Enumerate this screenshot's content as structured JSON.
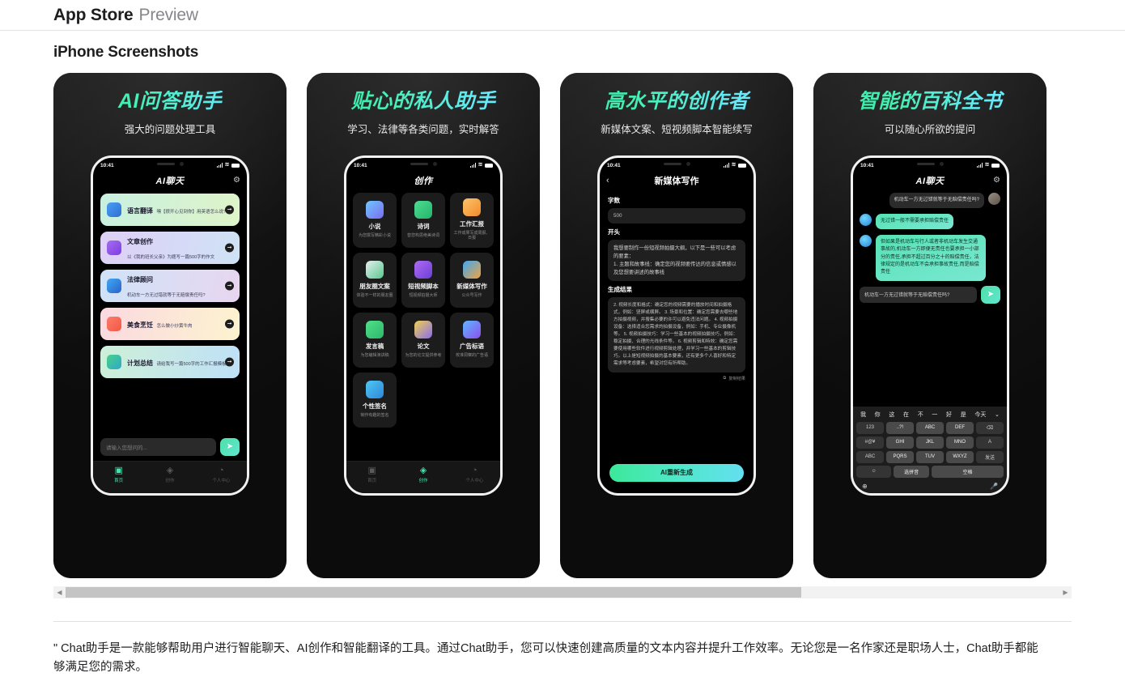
{
  "header": {
    "brand": "App Store",
    "preview": "Preview"
  },
  "section": {
    "title": "iPhone Screenshots"
  },
  "scrollbar": {
    "left_arrow": "◀",
    "right_arrow": "▶"
  },
  "description": "\" Chat助手是一款能够帮助用户进行智能聊天、AI创作和智能翻译的工具。通过Chat助手，您可以快速创建高质量的文本内容并提升工作效率。无论您是一名作家还是职场人士，Chat助手都能够满足您的需求。",
  "shots": [
    {
      "title": "AI问答助手",
      "subtitle": "强大的问题处理工具",
      "status": {
        "time": "10:41",
        "wifi": "◥"
      },
      "nav": {
        "title": "AI聊天",
        "right_icon": "⚙"
      },
      "cards": [
        {
          "title": "语言翻译",
          "desc": "嘿【很开心见到你】用英语怎么说?",
          "arrow": "➞"
        },
        {
          "title": "文章创作",
          "desc": "以《我的班长父亲》为题写一篇500字的作文",
          "arrow": "➞"
        },
        {
          "title": "法律顾问",
          "desc": "机动车一方无过错就等于无赔偿责任吗?",
          "arrow": "➞"
        },
        {
          "title": "美食烹饪",
          "desc": "怎么做小炒黄牛肉",
          "arrow": "➞"
        },
        {
          "title": "计划总结",
          "desc": "请给我写一篇500字的工作汇报模板",
          "arrow": "➞"
        }
      ],
      "input_placeholder": "请输入您想问的...",
      "send_icon": "➤",
      "tabs": [
        {
          "label": "首页",
          "icon": "▣",
          "active": true
        },
        {
          "label": "创作",
          "icon": "◈",
          "active": false
        },
        {
          "label": "个人中心",
          "icon": "◔",
          "active": false
        }
      ]
    },
    {
      "title": "贴心的私人助手",
      "subtitle": "学习、法律等各类问题，实时解答",
      "status": {
        "time": "10:41"
      },
      "nav": {
        "title": "创作"
      },
      "grid": [
        {
          "title": "小说",
          "desc": "为您撰写精彩小说"
        },
        {
          "title": "诗词",
          "desc": "替您构思绝美诗词"
        },
        {
          "title": "工作汇报",
          "desc": "工作成果写成周报、日报"
        },
        {
          "title": "朋友圈文案",
          "desc": "体验不一样的朋友圈"
        },
        {
          "title": "短视频脚本",
          "desc": "短视频拍摄大师"
        },
        {
          "title": "新媒体写作",
          "desc": "公众号写作"
        },
        {
          "title": "发言稿",
          "desc": "为您编辑演讲稿"
        },
        {
          "title": "论文",
          "desc": "为您的论文提供参考"
        },
        {
          "title": "广告标语",
          "desc": "校准洞察的广告语"
        },
        {
          "title": "个性签名",
          "desc": "制作有趣的签名"
        }
      ],
      "tabs": [
        {
          "label": "首页",
          "icon": "▣",
          "active": false
        },
        {
          "label": "创作",
          "icon": "◈",
          "active": true
        },
        {
          "label": "个人中心",
          "icon": "◔",
          "active": false
        }
      ]
    },
    {
      "title": "高水平的创作者",
      "subtitle": "新媒体文案、短视频脚本智能续写",
      "status": {
        "time": "10:41"
      },
      "nav": {
        "back_icon": "‹",
        "title": "新媒体写作"
      },
      "form": {
        "wordcount_label": "字数",
        "wordcount_value": "500",
        "opening_label": "开头",
        "opening_value": "我想要制作一份短视频拍摄大纲，以下是一些可以考虑的要素：\n1. 主题和故事线：确定您的视频要传达的信息或情感以及您想要讲述的故事线",
        "result_label": "生成结果",
        "result_value": "2. 视频长度和格式：确定您的视频需要的播放时间和拍摄格式，例如：竖屏或横屏。 3. 场景和位置：确定您需要去哪些地方拍摄视频，并搜集必要的许可以避免违法问题。 4. 视频拍摄设备：选择适合您需求的拍摄设备，例如：手机、专业摄像机等。 5. 视频拍摄技巧：学习一些基本的视频拍摄技巧，例如：稳定拍摄、合理的光线条件等。 6. 视频剪辑和特效：确定您需要使用哪些软件进行视频剪辑处理，并学习一些基本的剪辑技巧。以上是短视频拍摄的基本要素，还有更多个人喜好和特定需求等考虑要素，希望对您有所帮助。",
        "copy_label": "复制结果",
        "copy_icon": "⧉",
        "regen_label": "AI重新生成"
      }
    },
    {
      "title": "智能的百科全书",
      "subtitle": "可以随心所欲的提问",
      "status": {
        "time": "10:41"
      },
      "nav": {
        "title": "AI聊天",
        "right_icon": "⚙"
      },
      "messages": [
        {
          "from": "user",
          "text": "机动车一方无过错就等于无赔偿责任吗?"
        },
        {
          "from": "bot",
          "text": "无过错一般不需要承担赔偿责任"
        },
        {
          "from": "bot",
          "text": "但如果是机动车与行人或者非机动车发生交通事故的,机动车一方即便无责任也要承担一小部分的责任,承担不超过百分之十的赔偿责任，法律规定的是机动车不会承担事故责任,而是赔偿责任"
        }
      ],
      "input_value": "机动车一方无过错就等于无赔偿责任吗?",
      "send_icon": "➤",
      "keyboard": {
        "suggestions": [
          "我",
          "你",
          "这",
          "在",
          "不",
          "一",
          "好",
          "是",
          "今天"
        ],
        "chevron": "⌄",
        "rows": [
          [
            "123",
            "..?!",
            "ABC",
            "DEF",
            "⌫"
          ],
          [
            "#@¥",
            "GHI",
            "JKL",
            "MNO",
            "A"
          ],
          [
            "ABC",
            "PQRS",
            "TUV",
            "WXYZ",
            "发送"
          ],
          [
            "☺",
            "选拼音",
            "空格"
          ]
        ],
        "globe_icon": "⊕",
        "mic_icon": "🎤"
      }
    }
  ]
}
